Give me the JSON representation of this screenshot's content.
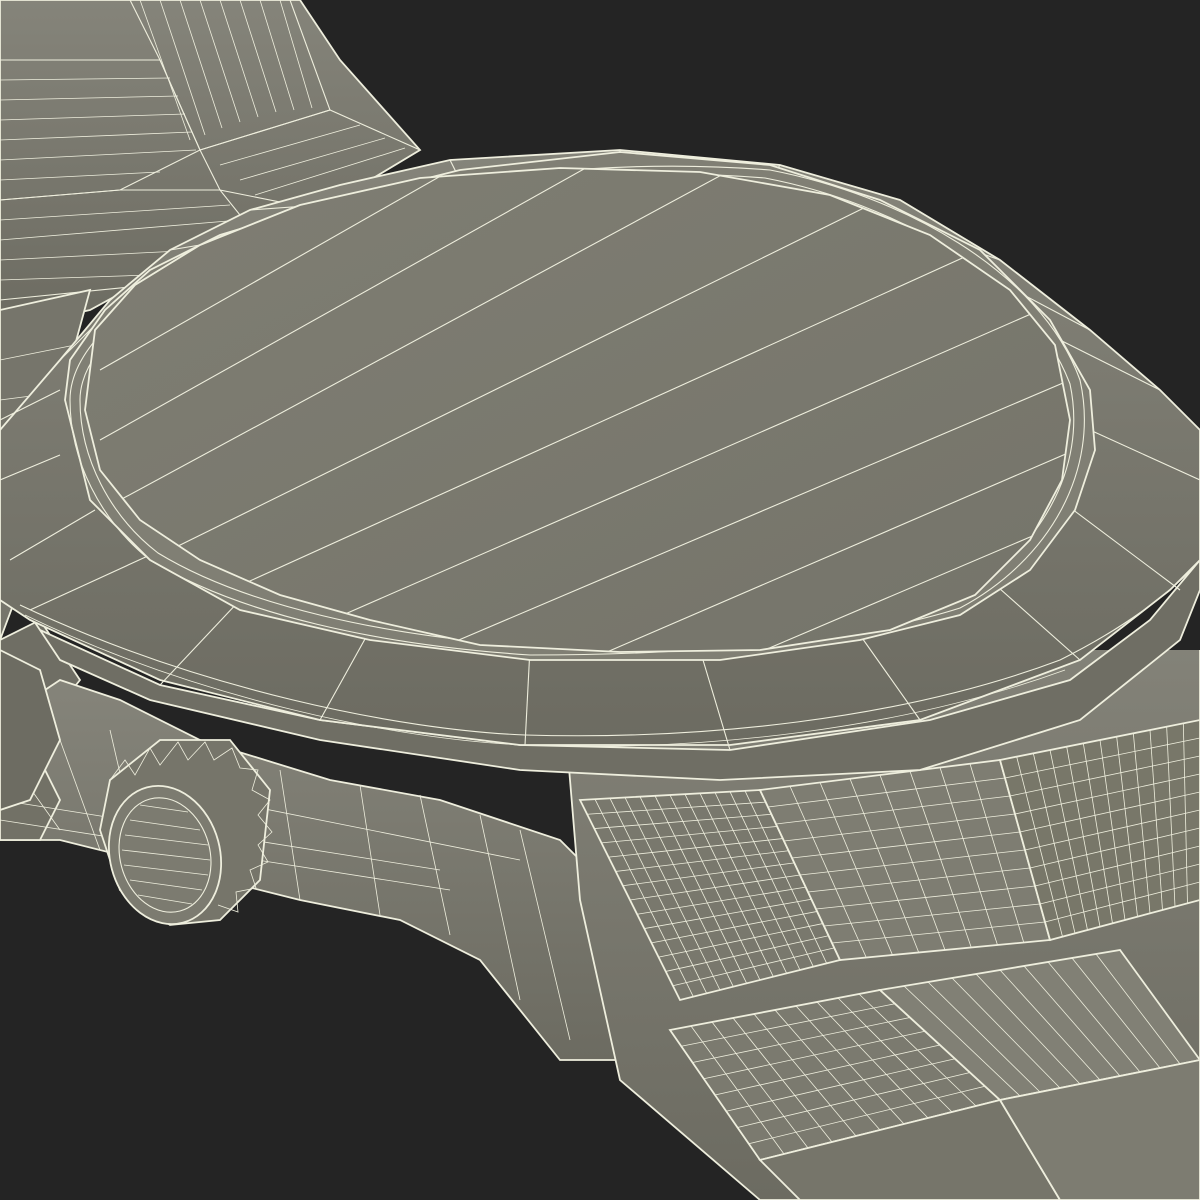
{
  "scene": {
    "subject": "watch",
    "background_color": "#242424",
    "surface_color": "#7c7b6f",
    "shadow_color": "#6b6a60",
    "wire_color": "#eeeedd"
  }
}
